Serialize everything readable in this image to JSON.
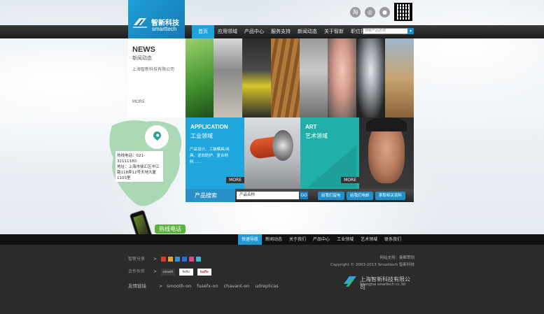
{
  "header": {
    "logo_cn": "智新科技",
    "logo_en": "smarttech",
    "search_placeholder": "搜索产品名称"
  },
  "nav": {
    "items": [
      "首页",
      "应用领域",
      "产品中心",
      "服务支持",
      "新闻动态",
      "关于智新",
      "职位招聘"
    ]
  },
  "news": {
    "title": "NEWS",
    "subtitle": "新闻动态",
    "item": "上海智新科技有限公司",
    "more": "MORE"
  },
  "contact": {
    "hotline": "热线电话：021-32111180",
    "address": "地址：上海市徐汇区中江路118弄12号天地大厦1103室"
  },
  "application": {
    "heading": "APPLICATION",
    "subtitle": "工业领域",
    "desc": "产品设计、工装模具/夹具、逆向防护、复合材料……",
    "more": "MORE"
  },
  "art": {
    "heading": "ART",
    "subtitle": "艺术领域",
    "more": "MORE"
  },
  "product_search": {
    "label": "产品搜索",
    "input_value": "产品名称",
    "go": "GO",
    "buttons": [
      "给我们留电",
      "给我们电邮",
      "索取相关资料"
    ]
  },
  "hotline": {
    "tag": "热线电话",
    "number": "021-32111180"
  },
  "footer_nav": {
    "items": [
      "快速导航",
      "新闻动态",
      "关于我们",
      "产品中心",
      "工业领域",
      "艺术领域",
      "联系我们"
    ]
  },
  "footer": {
    "share_label": "智新分享",
    "partners_label": "合作伙伴",
    "links_label": "友情链接",
    "partners": [
      "smooth",
      "ReRo",
      "Gaffe"
    ],
    "links": [
      "smooth-on",
      "fusefx-on",
      "chavant-on",
      "udreplicas"
    ],
    "support": "网站支持：曼都策划",
    "copyright": "Copyright © 2003-2013 Smarttech 智新科技",
    "company_cn": "上海智新科技有限公司",
    "company_en": "Shanghai smarttech co.,ltd"
  },
  "colors": {
    "accent_blue": "#1da3d8",
    "teal": "#21b0a9",
    "green_tag": "#5bb33d"
  }
}
